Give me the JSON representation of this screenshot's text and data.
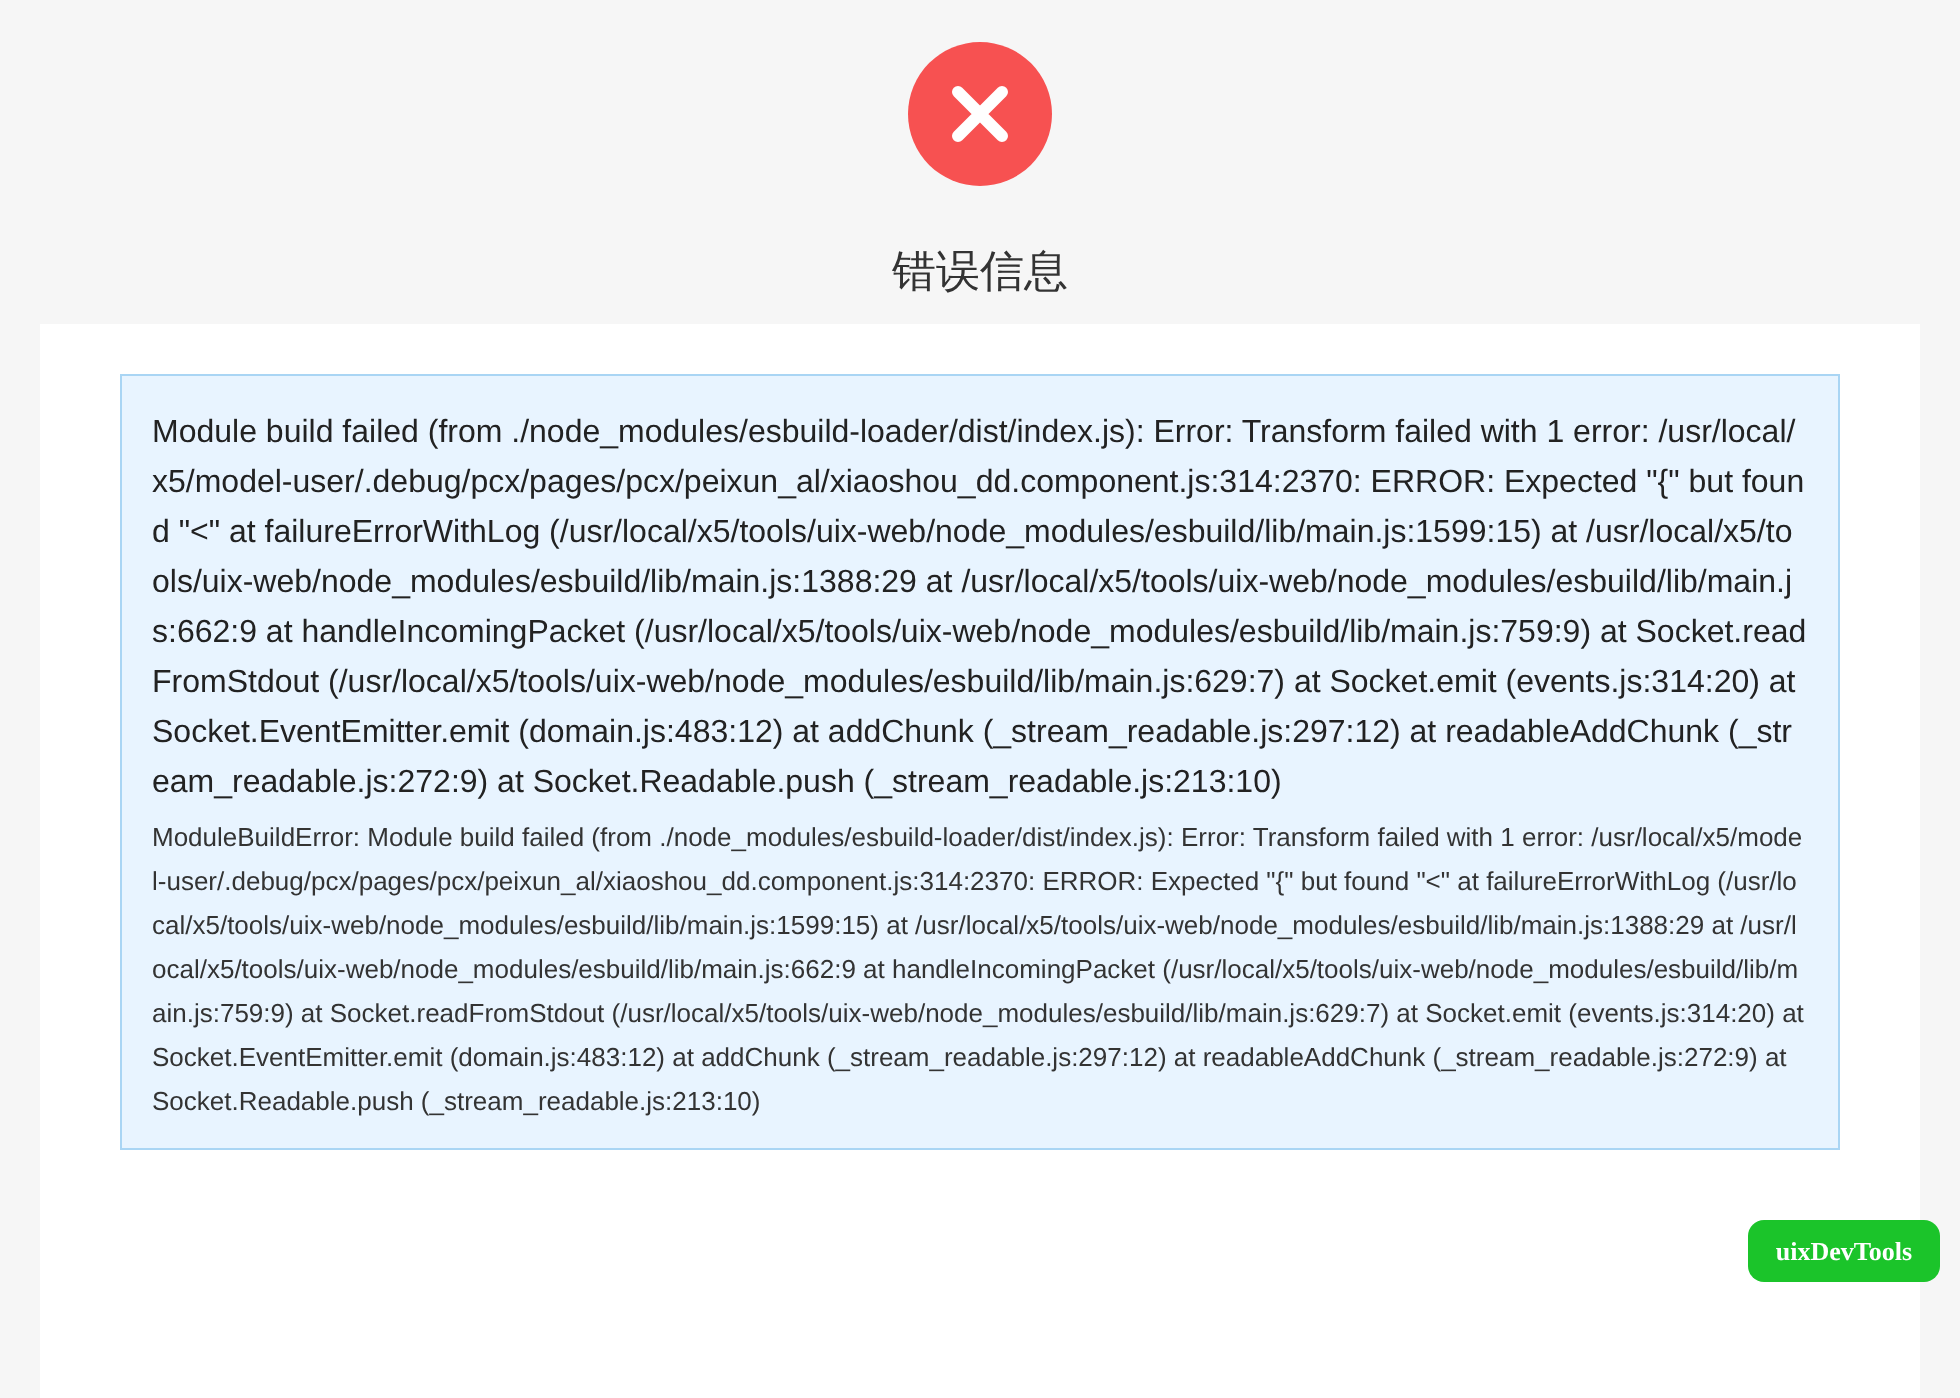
{
  "title": "错误信息",
  "error": {
    "message": "Module build failed (from ./node_modules/esbuild-loader/dist/index.js): Error: Transform failed with 1 error: /usr/local/x5/model-user/.debug/pcx/pages/pcx/peixun_al/xiaoshou_dd.component.js:314:2370: ERROR: Expected \"{\" but found \"<\" at failureErrorWithLog (/usr/local/x5/tools/uix-web/node_modules/esbuild/lib/main.js:1599:15) at /usr/local/x5/tools/uix-web/node_modules/esbuild/lib/main.js:1388:29 at /usr/local/x5/tools/uix-web/node_modules/esbuild/lib/main.js:662:9 at handleIncomingPacket (/usr/local/x5/tools/uix-web/node_modules/esbuild/lib/main.js:759:9) at Socket.readFromStdout (/usr/local/x5/tools/uix-web/node_modules/esbuild/lib/main.js:629:7) at Socket.emit (events.js:314:20) at Socket.EventEmitter.emit (domain.js:483:12) at addChunk (_stream_readable.js:297:12) at readableAddChunk (_stream_readable.js:272:9) at Socket.Readable.push (_stream_readable.js:213:10)",
    "stack": "ModuleBuildError: Module build failed (from ./node_modules/esbuild-loader/dist/index.js): Error: Transform failed with 1 error: /usr/local/x5/model-user/.debug/pcx/pages/pcx/peixun_al/xiaoshou_dd.component.js:314:2370: ERROR: Expected \"{\" but found \"<\" at failureErrorWithLog (/usr/local/x5/tools/uix-web/node_modules/esbuild/lib/main.js:1599:15) at /usr/local/x5/tools/uix-web/node_modules/esbuild/lib/main.js:1388:29 at /usr/local/x5/tools/uix-web/node_modules/esbuild/lib/main.js:662:9 at handleIncomingPacket (/usr/local/x5/tools/uix-web/node_modules/esbuild/lib/main.js:759:9) at Socket.readFromStdout (/usr/local/x5/tools/uix-web/node_modules/esbuild/lib/main.js:629:7) at Socket.emit (events.js:314:20) at Socket.EventEmitter.emit (domain.js:483:12) at addChunk (_stream_readable.js:297:12) at readableAddChunk (_stream_readable.js:272:9) at Socket.Readable.push (_stream_readable.js:213:10)"
  },
  "devtools_button": "uixDevTools"
}
